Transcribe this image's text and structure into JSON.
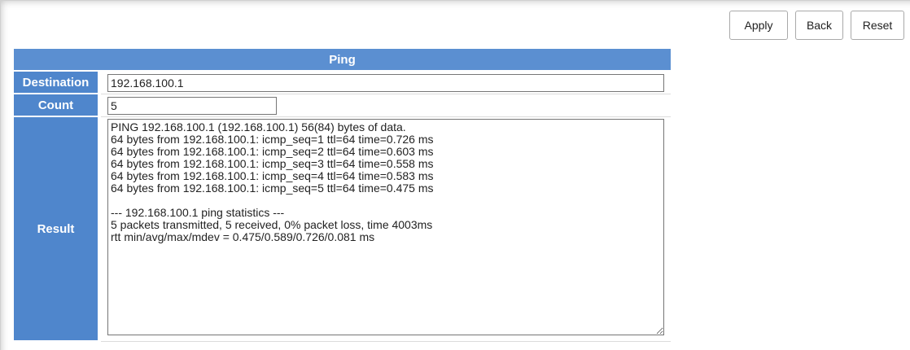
{
  "toolbar": {
    "apply_label": "Apply",
    "back_label": "Back",
    "reset_label": "Reset"
  },
  "ping": {
    "title": "Ping",
    "destination_label": "Destination",
    "destination_value": "192.168.100.1",
    "count_label": "Count",
    "count_value": "5",
    "result_label": "Result",
    "result_text": "PING 192.168.100.1 (192.168.100.1) 56(84) bytes of data.\n64 bytes from 192.168.100.1: icmp_seq=1 ttl=64 time=0.726 ms\n64 bytes from 192.168.100.1: icmp_seq=2 ttl=64 time=0.603 ms\n64 bytes from 192.168.100.1: icmp_seq=3 ttl=64 time=0.558 ms\n64 bytes from 192.168.100.1: icmp_seq=4 ttl=64 time=0.583 ms\n64 bytes from 192.168.100.1: icmp_seq=5 ttl=64 time=0.475 ms\n\n--- 192.168.100.1 ping statistics ---\n5 packets transmitted, 5 received, 0% packet loss, time 4003ms\nrtt min/avg/max/mdev = 0.475/0.589/0.726/0.081 ms"
  },
  "colors": {
    "header_blue": "#5b8fd1",
    "label_blue": "#4f86cc"
  }
}
